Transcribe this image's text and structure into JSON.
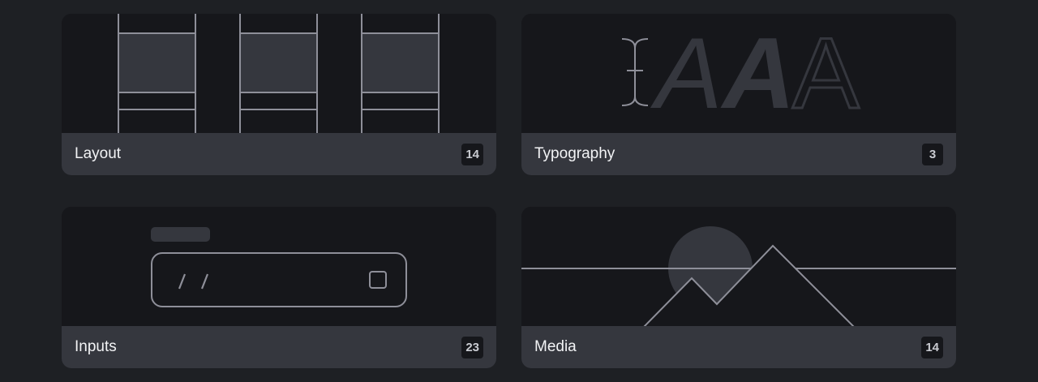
{
  "categories": [
    {
      "label": "Layout",
      "count": "14",
      "illustration": "layout-columns-icon"
    },
    {
      "label": "Typography",
      "count": "3",
      "illustration": "typography-letters-icon"
    },
    {
      "label": "Inputs",
      "count": "23",
      "illustration": "text-input-field-icon"
    },
    {
      "label": "Media",
      "count": "14",
      "illustration": "image-mountains-sun-icon"
    }
  ],
  "typography_preview": {
    "glyph_1": "A",
    "glyph_2": "A",
    "glyph_3": "A"
  },
  "colors": {
    "page_background": "#1e2024",
    "card_preview": "#16171b",
    "card_footer": "#35373e",
    "stroke": "#8e8f99",
    "fill_block": "#35373e",
    "text": "#f2f3f5",
    "badge_text": "#c9cbd1"
  }
}
